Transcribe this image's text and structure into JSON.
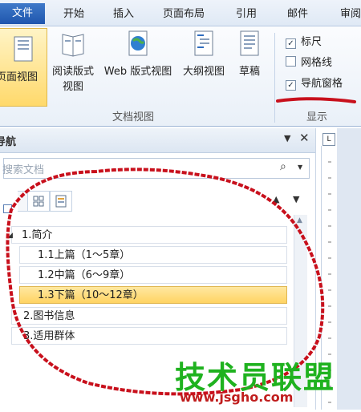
{
  "ribbon": {
    "tabs": [
      "文件",
      "开始",
      "插入",
      "页面布局",
      "引用",
      "邮件",
      "审阅"
    ],
    "doc_view_buttons": [
      {
        "label": "页面视图",
        "icon": "page-view-icon"
      },
      {
        "label": "阅读版式\n视图",
        "icon": "reading-layout-icon"
      },
      {
        "label": "Web 版式视图",
        "icon": "web-layout-icon"
      },
      {
        "label": "大纲视图",
        "icon": "outline-view-icon"
      },
      {
        "label": "草稿",
        "icon": "draft-icon"
      }
    ],
    "doc_view_group": "文档视图",
    "show_group": "显示",
    "show_options": [
      {
        "label": "标尺",
        "checked": true
      },
      {
        "label": "网格线",
        "checked": false
      },
      {
        "label": "导航窗格",
        "checked": true
      }
    ]
  },
  "nav": {
    "title": "导航",
    "search_placeholder": "搜索文档",
    "tree": [
      {
        "label": "1.简介",
        "level": 1,
        "selected": false
      },
      {
        "label": "1.1上篇（1～5章）",
        "level": 2,
        "selected": false
      },
      {
        "label": "1.2中篇（6～9章）",
        "level": 2,
        "selected": false
      },
      {
        "label": "1.3下篇（10～12章）",
        "level": 2,
        "selected": true
      },
      {
        "label": "2.图书信息",
        "level": 1,
        "selected": false
      },
      {
        "label": "3.适用群体",
        "level": 1,
        "selected": false
      }
    ]
  },
  "watermark": {
    "brand": "技术员联盟",
    "url": "www.jsgho.com"
  },
  "colors": {
    "accent": "#1f56ad",
    "selection": "#ffd463",
    "annotation": "#c8101c"
  }
}
